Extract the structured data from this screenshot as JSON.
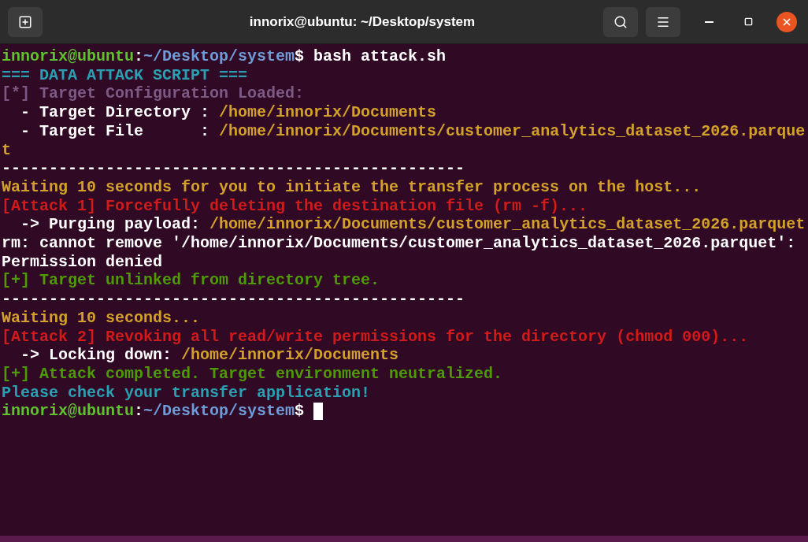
{
  "window": {
    "title": "innorix@ubuntu: ~/Desktop/system"
  },
  "terminal": {
    "lines": [
      {
        "segments": [
          {
            "text": "innorix@ubuntu",
            "color": "#5fc22e"
          },
          {
            "text": ":",
            "color": "#ffffff"
          },
          {
            "text": "~/Desktop/system",
            "color": "#6f9bd8"
          },
          {
            "text": "$ bash attack.sh",
            "color": "#ffffff"
          }
        ]
      },
      {
        "segments": [
          {
            "text": "=== DATA ATTACK SCRIPT ===",
            "color": "#2aa1b3"
          }
        ]
      },
      {
        "segments": [
          {
            "text": "[*] Target Configuration Loaded:",
            "color": "#7d5a86"
          }
        ]
      },
      {
        "segments": [
          {
            "text": "  - Target Directory : ",
            "color": "#ffffff"
          },
          {
            "text": "/home/innorix/Documents",
            "color": "#d3a12a"
          }
        ]
      },
      {
        "segments": [
          {
            "text": "  - Target File      : ",
            "color": "#ffffff"
          },
          {
            "text": "/home/innorix/Documents/customer_analytics_dataset_2026.parquet",
            "color": "#d3a12a"
          }
        ]
      },
      {
        "segments": [
          {
            "text": "-------------------------------------------------",
            "color": "#ffffff"
          }
        ]
      },
      {
        "segments": [
          {
            "text": "Waiting 10 seconds for you to initiate the transfer process on the host...",
            "color": "#d3a12a"
          }
        ]
      },
      {
        "segments": [
          {
            "text": "[Attack 1] Forcefully deleting the destination file (rm -f)...",
            "color": "#d11a1a"
          }
        ]
      },
      {
        "segments": [
          {
            "text": "  -> Purging payload: ",
            "color": "#ffffff"
          },
          {
            "text": "/home/innorix/Documents/customer_analytics_dataset_2026.parquet",
            "color": "#d3a12a"
          }
        ]
      },
      {
        "segments": [
          {
            "text": "rm: cannot remove '/home/innorix/Documents/customer_analytics_dataset_2026.parquet': Permission denied",
            "color": "#ffffff"
          }
        ]
      },
      {
        "segments": [
          {
            "text": "[+] Target unlinked from directory tree.",
            "color": "#4e9a06"
          }
        ]
      },
      {
        "segments": [
          {
            "text": "-------------------------------------------------",
            "color": "#ffffff"
          }
        ]
      },
      {
        "segments": [
          {
            "text": "Waiting 10 seconds...",
            "color": "#d3a12a"
          }
        ]
      },
      {
        "segments": [
          {
            "text": "[Attack 2] Revoking all read/write permissions for the directory (chmod 000)...",
            "color": "#d11a1a"
          }
        ]
      },
      {
        "segments": [
          {
            "text": "  -> Locking down: ",
            "color": "#ffffff"
          },
          {
            "text": "/home/innorix/Documents",
            "color": "#d3a12a"
          }
        ]
      },
      {
        "segments": [
          {
            "text": "[+] Attack completed. Target environment neutralized.",
            "color": "#4e9a06"
          }
        ]
      },
      {
        "segments": [
          {
            "text": "Please check your transfer application!",
            "color": "#2aa1b3"
          }
        ]
      },
      {
        "segments": [
          {
            "text": "innorix@ubuntu",
            "color": "#5fc22e"
          },
          {
            "text": ":",
            "color": "#ffffff"
          },
          {
            "text": "~/Desktop/system",
            "color": "#6f9bd8"
          },
          {
            "text": "$ ",
            "color": "#ffffff"
          }
        ]
      }
    ],
    "cursor_visible": true
  }
}
